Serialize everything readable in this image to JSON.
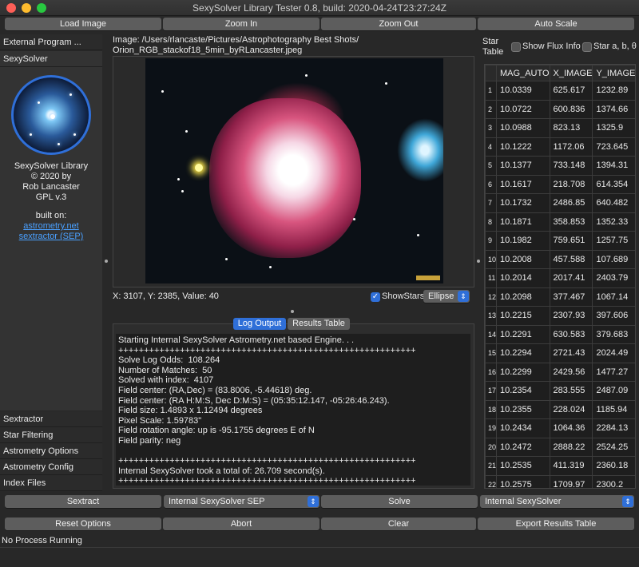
{
  "window": {
    "title": "SexySolver Library Tester 0.8, build: 2020-04-24T23:27:24Z"
  },
  "toolbar": {
    "load_image": "Load Image",
    "zoom_in": "Zoom In",
    "zoom_out": "Zoom Out",
    "auto_scale": "Auto Scale"
  },
  "side_tabs": {
    "external_program": "External Program ...",
    "sexysolver": "SexySolver",
    "sextractor": "Sextractor",
    "star_filtering": "Star Filtering",
    "astrometry_options": "Astrometry Options",
    "astrometry_config": "Astrometry Config",
    "index_files": "Index Files"
  },
  "about": {
    "line1": "SexySolver Library",
    "line2": "© 2020 by",
    "line3": "Rob Lancaster",
    "line4": "GPL v.3",
    "built_on": "built on:",
    "link1": "astrometry.net",
    "link2": "sextractor (SEP)"
  },
  "image": {
    "label_line1": "Image: /Users/rlancaste/Pictures/Astrophotography Best Shots/",
    "label_line2": "Orion_RGB_stackof18_5min_byRLancaster.jpeg",
    "coords": "X: 3107, Y: 2385, Value: 40",
    "show_stars": "ShowStars",
    "star_shape": "Ellipse"
  },
  "log_tabs": {
    "log_output": "Log Output",
    "results_table": "Results Table"
  },
  "log_text": "Starting Internal SexySolver Astrometry.net based Engine. . .\n++++++++++++++++++++++++++++++++++++++++++++++++++++++++++\nSolve Log Odds:  108.264\nNumber of Matches:  50\nSolved with index:  4107\nField center: (RA,Dec) = (83.8006, -5.44618) deg.\nField center: (RA H:M:S, Dec D:M:S) = (05:35:12.147, -05:26:46.243).\nField size: 1.4893 x 1.12494 degrees\nPixel Scale: 1.59783\"\nField rotation angle: up is -95.1755 degrees E of N\nField parity: neg\n\n++++++++++++++++++++++++++++++++++++++++++++++++++++++++++\nInternal SexySolver took a total of: 26.709 second(s).\n++++++++++++++++++++++++++++++++++++++++++++++++++++++++++",
  "star_table": {
    "header_line1": "Star",
    "header_line2": "Table",
    "flux_label": "Show Flux Info",
    "abtheta_label": "Star a, b, θ",
    "columns": [
      "MAG_AUTO",
      "X_IMAGE",
      "Y_IMAGE"
    ],
    "rows": [
      [
        "1",
        "10.0339",
        "625.617",
        "1232.89"
      ],
      [
        "2",
        "10.0722",
        "600.836",
        "1374.66"
      ],
      [
        "3",
        "10.0988",
        "823.13",
        "1325.9"
      ],
      [
        "4",
        "10.1222",
        "1172.06",
        "723.645"
      ],
      [
        "5",
        "10.1377",
        "733.148",
        "1394.31"
      ],
      [
        "6",
        "10.1617",
        "218.708",
        "614.354"
      ],
      [
        "7",
        "10.1732",
        "2486.85",
        "640.482"
      ],
      [
        "8",
        "10.1871",
        "358.853",
        "1352.33"
      ],
      [
        "9",
        "10.1982",
        "759.651",
        "1257.75"
      ],
      [
        "10",
        "10.2008",
        "457.588",
        "107.689"
      ],
      [
        "11",
        "10.2014",
        "2017.41",
        "2403.79"
      ],
      [
        "12",
        "10.2098",
        "377.467",
        "1067.14"
      ],
      [
        "13",
        "10.2215",
        "2307.93",
        "397.606"
      ],
      [
        "14",
        "10.2291",
        "630.583",
        "379.683"
      ],
      [
        "15",
        "10.2294",
        "2721.43",
        "2024.49"
      ],
      [
        "16",
        "10.2299",
        "2429.56",
        "1477.27"
      ],
      [
        "17",
        "10.2354",
        "283.555",
        "2487.09"
      ],
      [
        "18",
        "10.2355",
        "228.024",
        "1185.94"
      ],
      [
        "19",
        "10.2434",
        "1064.36",
        "2284.13"
      ],
      [
        "20",
        "10.2472",
        "2888.22",
        "2524.25"
      ],
      [
        "21",
        "10.2535",
        "411.319",
        "2360.18"
      ],
      [
        "22",
        "10.2575",
        "1709.97",
        "2300.2"
      ]
    ]
  },
  "bottom": {
    "sextract": "Sextract",
    "sextract_engine": "Internal SexySolver SEP",
    "solve": "Solve",
    "solve_engine": "Internal SexySolver",
    "reset_options": "Reset Options",
    "abort": "Abort",
    "clear": "Clear",
    "export": "Export Results Table"
  },
  "status": "No Process Running",
  "colors": {
    "accent": "#2f6fd8",
    "window_bg": "#282828",
    "link": "#4aa0ff"
  }
}
